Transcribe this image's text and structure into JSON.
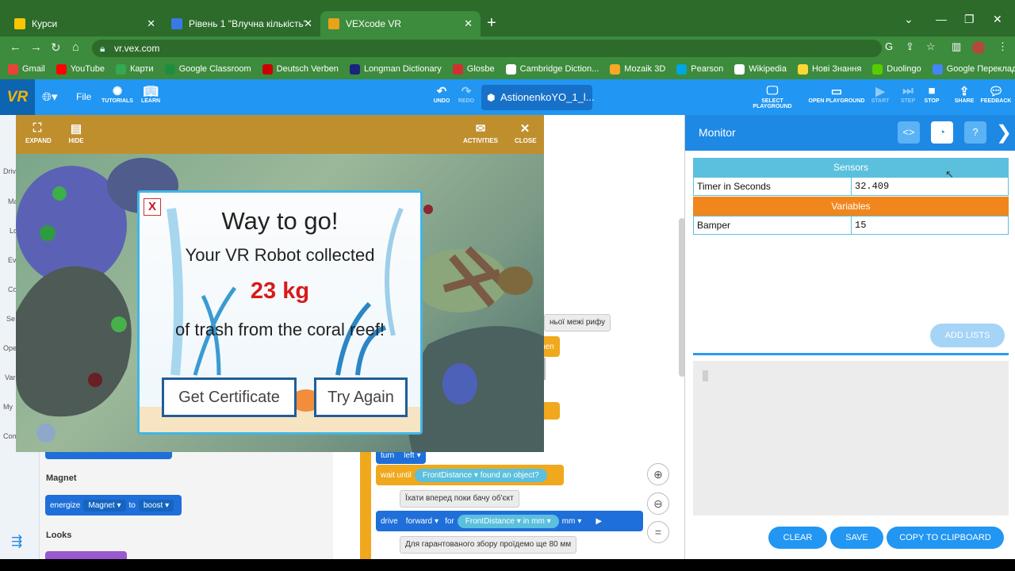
{
  "browser": {
    "tabs": [
      {
        "title": "Курси",
        "icon_color": "#f7c600"
      },
      {
        "title": "Рівень 1 \"Влучна кількість\"",
        "icon_color": "#3b78e7"
      },
      {
        "title": "VEXcode VR",
        "icon_color": "#e8a317"
      }
    ],
    "url": "vr.vex.com",
    "bookmarks": [
      {
        "label": "Gmail",
        "color": "#ea4335"
      },
      {
        "label": "YouTube",
        "color": "#ff0000"
      },
      {
        "label": "Карти",
        "color": "#34a853"
      },
      {
        "label": "Google Classroom",
        "color": "#1e8e3e"
      },
      {
        "label": "Deutsch Verben",
        "color": "#cc0000"
      },
      {
        "label": "Longman Dictionary",
        "color": "#1a237e"
      },
      {
        "label": "Glosbe",
        "color": "#d32f2f"
      },
      {
        "label": "Cambridge Diction...",
        "color": "#ffffff"
      },
      {
        "label": "Mozaik 3D",
        "color": "#f9a825"
      },
      {
        "label": "Pearson",
        "color": "#00a5e3"
      },
      {
        "label": "Wikipedia",
        "color": "#ffffff"
      },
      {
        "label": "Нові Знання",
        "color": "#fdd835"
      },
      {
        "label": "Duolingo",
        "color": "#58cc02"
      },
      {
        "label": "Google Перекладач",
        "color": "#4285f4"
      }
    ]
  },
  "toolbar": {
    "logo": "VR",
    "file": "File",
    "tutorials": "TUTORIALS",
    "learn": "LEARN",
    "undo": "UNDO",
    "redo": "REDO",
    "project": "AstionenkoYO_1_l...",
    "select_playground": "SELECT PLAYGROUND",
    "open_playground": "OPEN PLAYGROUND",
    "start": "START",
    "step": "STEP",
    "stop": "STOP",
    "share": "SHARE",
    "feedback": "FEEDBACK"
  },
  "categories": [
    "Driv",
    "Ma",
    "Lo",
    "Ev",
    "Co",
    "Se",
    "Ope",
    "Var",
    "My",
    "Com"
  ],
  "palette": {
    "magnet_heading": "Magnet",
    "energize_block": {
      "word": "energize",
      "item": "Magnet",
      "to": "to",
      "action": "boost"
    },
    "looks_heading": "Looks"
  },
  "workspace": {
    "comment_reef": "ньої межі рифу",
    "then": "hen",
    "turn_block": {
      "word": "turn",
      "dir": "left"
    },
    "wait_block": {
      "word": "wait until",
      "sensor": "FrontDistance",
      "cond": "found an object?"
    },
    "comment_drive": "Їхати вперед поки бачу об'єкт",
    "drive_block": {
      "word": "drive",
      "dir": "forward",
      "for": "for",
      "sensor": "FrontDistance",
      "in": "in",
      "unit1": "mm",
      "unit2": "mm"
    },
    "comment_collect": "Для гарантованого збору проїдемо ще 80 мм"
  },
  "playground": {
    "expand": "EXPAND",
    "hide": "HIDE",
    "activities": "ACTIVITIES",
    "close": "CLOSE"
  },
  "modal": {
    "close": "X",
    "title": "Way to go!",
    "line1": "Your VR Robot collected",
    "amount": "23 kg",
    "line2": "of trash from the coral reef!",
    "certificate": "Get Certificate",
    "try_again": "Try Again"
  },
  "monitor": {
    "title": "Monitor",
    "sensors_heading": "Sensors",
    "sensors": [
      {
        "name": "Timer in Seconds",
        "value": "32.409"
      }
    ],
    "variables_heading": "Variables",
    "variables": [
      {
        "name": "Bamper",
        "value": "15"
      }
    ],
    "add_lists": "ADD LISTS",
    "clear": "CLEAR",
    "save": "SAVE",
    "copy": "COPY TO CLIPBOARD"
  }
}
